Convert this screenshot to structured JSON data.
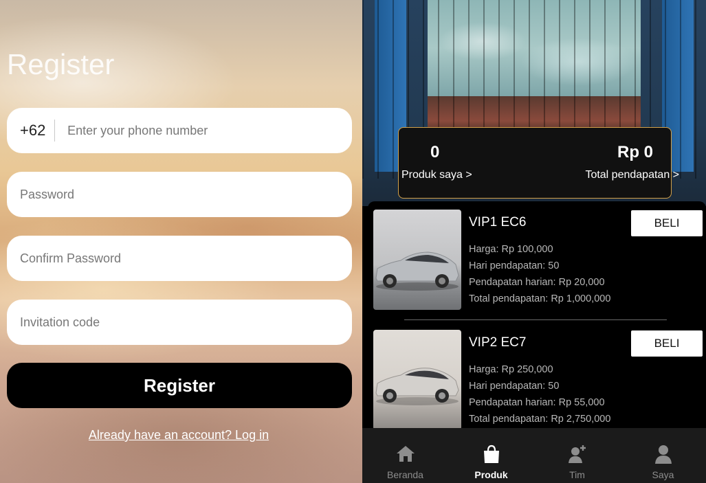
{
  "register": {
    "title": "Register",
    "phone_prefix": "+62",
    "phone_placeholder": "Enter your phone number",
    "password_placeholder": "Password",
    "confirm_password_placeholder": "Confirm Password",
    "invitation_placeholder": "Invitation code",
    "submit_label": "Register",
    "login_link": "Already have an account? Log in"
  },
  "stats": {
    "my_products_value": "0",
    "my_products_label": "Produk saya >",
    "total_income_value": "Rp 0",
    "total_income_label": "Total pendapatan >"
  },
  "products": [
    {
      "name": "VIP1 EC6",
      "buy_label": "BELI",
      "price": "Harga: Rp 100,000",
      "days": "Hari pendapatan: 50",
      "daily": "Pendapatan harian: Rp 20,000",
      "total": "Total pendapatan: Rp 1,000,000"
    },
    {
      "name": "VIP2 EC7",
      "buy_label": "BELI",
      "price": "Harga: Rp 250,000",
      "days": "Hari pendapatan: 50",
      "daily": "Pendapatan harian: Rp 55,000",
      "total": "Total pendapatan: Rp 2,750,000"
    }
  ],
  "nav": [
    {
      "label": "Beranda",
      "icon": "home-icon"
    },
    {
      "label": "Produk",
      "icon": "shopping-bag-icon",
      "active": true
    },
    {
      "label": "Tim",
      "icon": "add-user-icon"
    },
    {
      "label": "Saya",
      "icon": "user-icon"
    }
  ]
}
